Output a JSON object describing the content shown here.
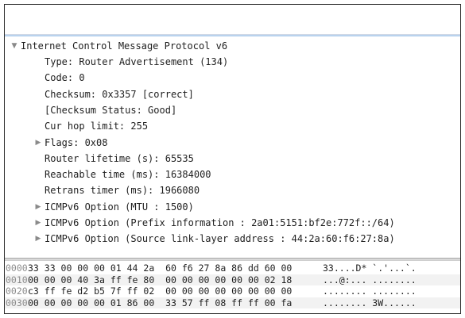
{
  "detail_tree": {
    "root": {
      "label": "Internet Control Message Protocol v6",
      "expanded": true
    },
    "fields": [
      {
        "label": "Type: Router Advertisement (134)",
        "expandable": false
      },
      {
        "label": "Code: 0",
        "expandable": false
      },
      {
        "label": "Checksum: 0x3357 [correct]",
        "expandable": false
      },
      {
        "label": "[Checksum Status: Good]",
        "expandable": false
      },
      {
        "label": "Cur hop limit: 255",
        "expandable": false
      },
      {
        "label": "Flags: 0x08",
        "expandable": true
      },
      {
        "label": "Router lifetime (s): 65535",
        "expandable": false
      },
      {
        "label": "Reachable time (ms): 16384000",
        "expandable": false
      },
      {
        "label": "Retrans timer (ms): 1966080",
        "expandable": false
      },
      {
        "label": "ICMPv6 Option (MTU : 1500)",
        "expandable": true
      },
      {
        "label": "ICMPv6 Option (Prefix information : 2a01:5151:bf2e:772f::/64)",
        "expandable": true
      },
      {
        "label": "ICMPv6 Option (Source link-layer address : 44:2a:60:f6:27:8a)",
        "expandable": true
      }
    ]
  },
  "hex_dump": [
    {
      "offset": "0000",
      "bytes": "33 33 00 00 00 01 44 2a  60 f6 27 8a 86 dd 60 00",
      "ascii": "33....D* `.'...`."
    },
    {
      "offset": "0010",
      "bytes": "00 00 00 40 3a ff fe 80  00 00 00 00 00 00 02 18",
      "ascii": "...@:... ........"
    },
    {
      "offset": "0020",
      "bytes": "c3 ff fe d2 b5 7f ff 02  00 00 00 00 00 00 00 00",
      "ascii": "........ ........"
    },
    {
      "offset": "0030",
      "bytes": "00 00 00 00 00 01 86 00  33 57 ff 08 ff ff 00 fa",
      "ascii": "........ 3W......"
    }
  ],
  "icons": {
    "expanded": "triangle-down-icon",
    "collapsed": "triangle-right-icon"
  },
  "colors": {
    "selection_line": "#b9d3ee",
    "text": "#1e1e1e",
    "offset_text": "#8c8c8c"
  }
}
